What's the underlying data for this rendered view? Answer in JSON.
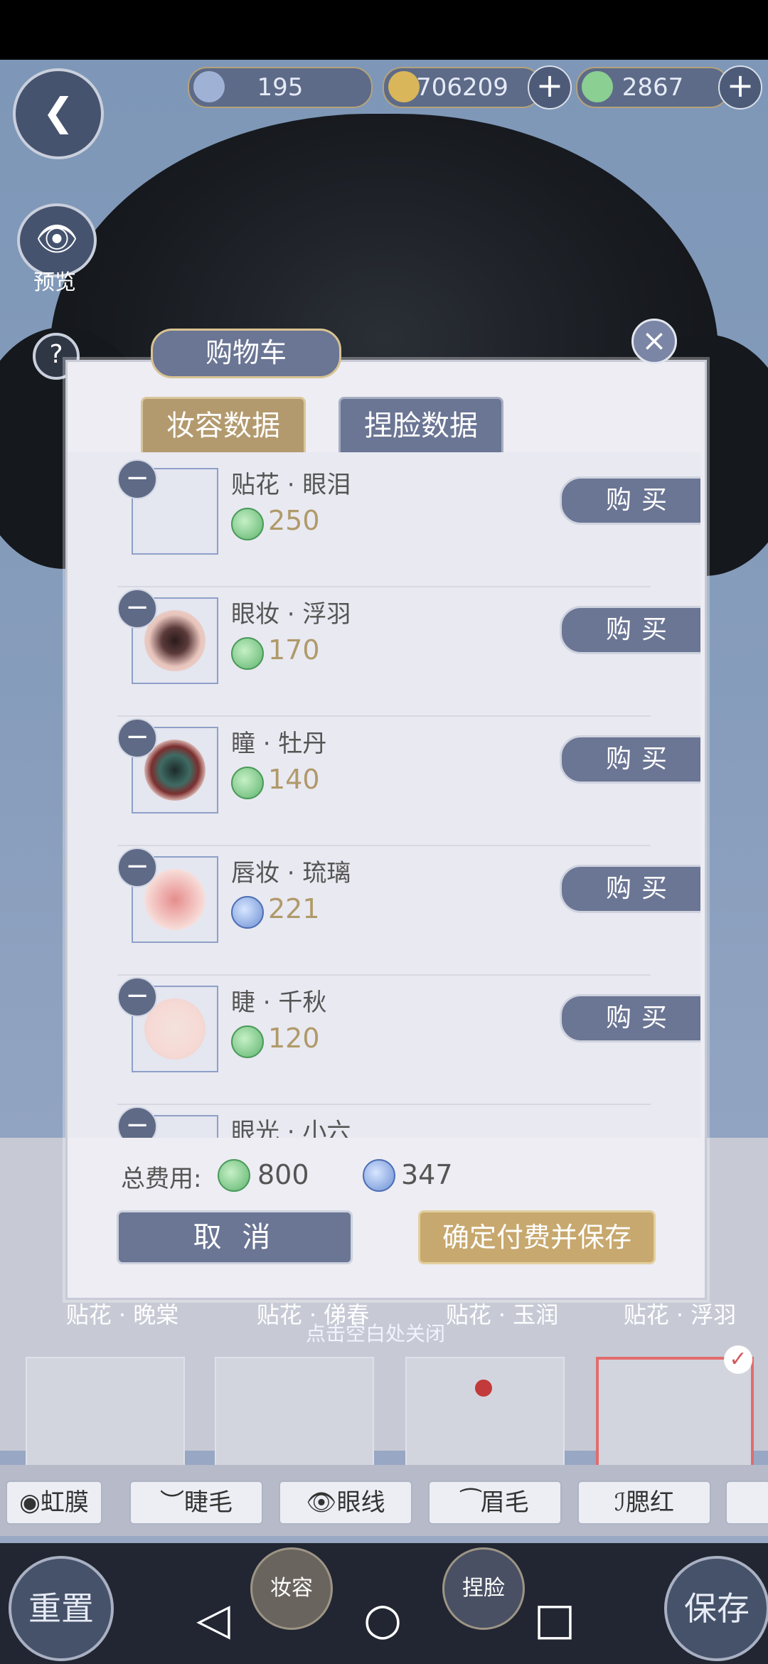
{
  "currency": {
    "diamond": "195",
    "coins": "706209",
    "jade": "2867"
  },
  "left_controls": {
    "preview_label": "预览",
    "help_symbol": "?"
  },
  "modal": {
    "title": "购物车",
    "close_symbol": "×",
    "tabs": [
      "妆容数据",
      "捏脸数据"
    ],
    "items": [
      {
        "name": "贴花 · 眼泪",
        "price": "250",
        "currency": "jade",
        "buy": "购买"
      },
      {
        "name": "眼妆 · 浮羽",
        "price": "170",
        "currency": "jade",
        "buy": "购买"
      },
      {
        "name": "瞳 · 牡丹",
        "price": "140",
        "currency": "jade",
        "buy": "购买"
      },
      {
        "name": "唇妆 · 琉璃",
        "price": "221",
        "currency": "diamond",
        "buy": "购买"
      },
      {
        "name": "睫 · 千秋",
        "price": "120",
        "currency": "jade",
        "buy": "购买"
      },
      {
        "name": "眼光 · 小六",
        "price": "",
        "currency": "jade",
        "buy": ""
      }
    ],
    "footer": {
      "total_label": "总费用:",
      "total_jade": "800",
      "total_diamond": "347",
      "cancel": "取 消",
      "confirm": "确定付费并保存"
    }
  },
  "background": {
    "below_items": [
      "贴花 · 晚棠",
      "贴花 · 俤春",
      "贴花 · 玉润",
      "贴花 · 浮羽"
    ],
    "click_hint": "点击空白处关闭",
    "chips": [
      "虹膜",
      "睫毛",
      "眼线",
      "眉毛",
      "腮红"
    ],
    "bottom_left": "重置",
    "bottom_right": "保存",
    "tab_makeup": "妆容",
    "tab_face": "捏脸"
  },
  "colors": {
    "modal_bg": "#ededf3",
    "button_purple": "#6b7594",
    "button_gold": "#c7a86e"
  }
}
